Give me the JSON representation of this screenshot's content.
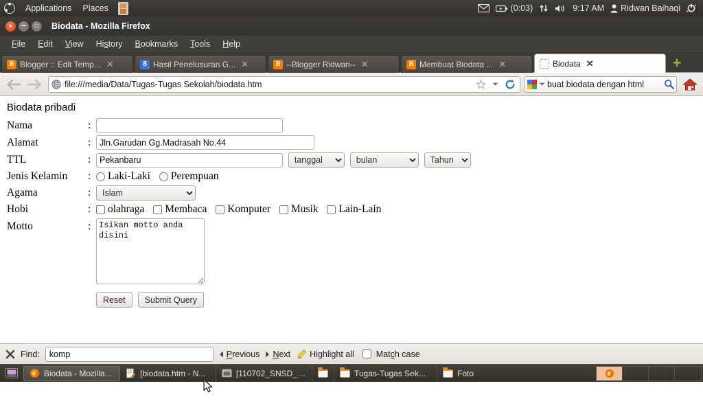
{
  "desktop": {
    "panel": {
      "applications_label": "Applications",
      "places_label": "Places",
      "film_icon": "film-strip-icon",
      "tray": {
        "mail_icon": "envelope-icon",
        "battery_icon": "battery-icon",
        "battery_time": "(0:03)",
        "network_icon": "network-updown-icon",
        "volume_icon": "volume-icon",
        "clock": "9:17 AM",
        "user_icon": "user-icon",
        "user_name": "Ridwan Baihaqi",
        "session_icon": "power-gear-icon"
      }
    },
    "taskbar": {
      "show_desktop_icon": "show-desktop-icon",
      "items": [
        {
          "icon": "firefox-icon",
          "label": "Biodata - Mozilla...",
          "active": true
        },
        {
          "icon": "notepad-icon",
          "label": "[biodata.htm - N...",
          "active": false
        },
        {
          "icon": "film-icon",
          "label": "[110702_SNSD_-...",
          "active": false
        },
        {
          "icon": "folder-icon",
          "label": "",
          "active": false
        },
        {
          "icon": "folder-icon",
          "label": "Tugas-Tugas Sek...",
          "active": false
        },
        {
          "icon": "folder-icon",
          "label": "Foto",
          "active": false
        }
      ],
      "workspaces": [
        {
          "active": true,
          "icon": "firefox-icon"
        },
        {
          "active": false,
          "icon": ""
        },
        {
          "active": false,
          "icon": ""
        },
        {
          "active": false,
          "icon": ""
        }
      ]
    }
  },
  "browser": {
    "window_title": "Biodata - Mozilla Firefox",
    "window_buttons": {
      "close": "×",
      "minimize": "−",
      "maximize": "□"
    },
    "menus": [
      {
        "label": "File",
        "key": "F"
      },
      {
        "label": "Edit",
        "key": "E"
      },
      {
        "label": "View",
        "key": "V"
      },
      {
        "label": "History",
        "key": "s"
      },
      {
        "label": "Bookmarks",
        "key": "B"
      },
      {
        "label": "Tools",
        "key": "T"
      },
      {
        "label": "Help",
        "key": "H"
      }
    ],
    "tabs": [
      {
        "favicon": "blogger-icon",
        "title": "Blogger :: Edit Temp...",
        "active": false
      },
      {
        "favicon": "google-icon",
        "title": "Hasil Penelusuran G...",
        "active": false
      },
      {
        "favicon": "blogger-icon",
        "title": "--Blogger Ridwan--",
        "active": false
      },
      {
        "favicon": "blogger-icon",
        "title": "Membuat Biodata ...",
        "active": false
      },
      {
        "favicon": "blank-page-icon",
        "title": "Biodata",
        "active": true
      }
    ],
    "tab_close_label": "✕",
    "new_tab_label": "+",
    "nav": {
      "back_icon": "back-arrow-icon",
      "forward_icon": "forward-arrow-icon",
      "site_icon": "globe-icon",
      "url": "file:///media/Data/Tugas-Tugas Sekolah/biodata.htm",
      "bookmark_icon": "star-icon",
      "dropmarker_icon": "chevron-down-icon",
      "reload_icon": "reload-icon",
      "home_icon": "home-icon"
    },
    "search": {
      "engine_icon": "google-icon",
      "dropmarker_icon": "chevron-down-icon",
      "value": "buat biodata dengan html",
      "go_icon": "magnifier-icon"
    }
  },
  "page": {
    "title": "Biodata pribadi",
    "colon": ":",
    "fields": {
      "nama": {
        "label": "Nama",
        "value": ""
      },
      "alamat": {
        "label": "Alamat",
        "value": "Jln.Garudan Gg.Madrasah No.44"
      },
      "ttl": {
        "label": "TTL",
        "value": "Pekanbaru",
        "selects": [
          {
            "name": "tanggal",
            "selected": "tanggal"
          },
          {
            "name": "bulan",
            "selected": "bulan"
          },
          {
            "name": "tahun",
            "selected": "Tahun"
          }
        ]
      },
      "jenis_kelamin": {
        "label": "Jenis Kelamin",
        "options": [
          {
            "label": "Laki-Laki",
            "checked": false
          },
          {
            "label": "Perempuan",
            "checked": false
          }
        ]
      },
      "agama": {
        "label": "Agama",
        "selected": "Islam"
      },
      "hobi": {
        "label": "Hobi",
        "options": [
          {
            "label": "olahraga",
            "checked": false
          },
          {
            "label": "Membaca",
            "checked": false
          },
          {
            "label": "Komputer",
            "checked": false
          },
          {
            "label": "Musik",
            "checked": false
          },
          {
            "label": "Lain-Lain",
            "checked": false
          }
        ]
      },
      "motto": {
        "label": "Motto",
        "value": "Isikan motto anda\ndisini"
      }
    },
    "buttons": {
      "reset": "Reset",
      "submit": "Submit Query"
    }
  },
  "findbar": {
    "close_icon": "close-icon",
    "label": "Find:",
    "value": "komp",
    "previous": "Previous",
    "previous_key": "P",
    "next": "Next",
    "next_key": "N",
    "highlight_icon": "highlighter-icon",
    "highlight_all": "Highlight all",
    "match_case": "Match case",
    "match_case_checked": false
  }
}
